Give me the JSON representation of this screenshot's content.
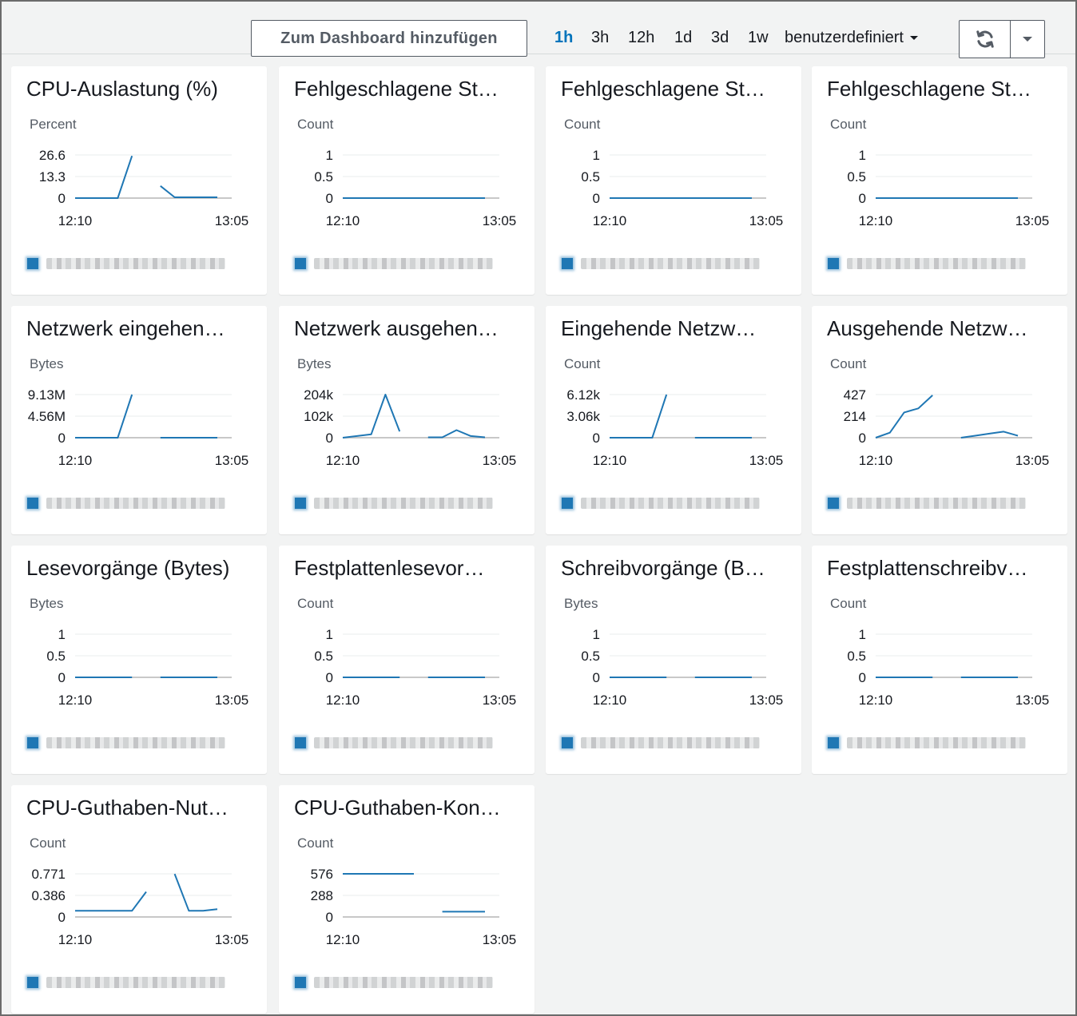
{
  "toolbar": {
    "add_to_dashboard_label": "Zum Dashboard hinzufügen",
    "ranges": [
      "1h",
      "3h",
      "12h",
      "1d",
      "3d",
      "1w",
      "benutzerdefiniert"
    ],
    "active_range": "1h",
    "refresh_icon": "refresh-icon",
    "dropdown_icon": "chevron-down-icon"
  },
  "colors": {
    "series": "#1f77b4",
    "gap": "#c8c8c8",
    "active_range": "#0073bb",
    "background": "#f2f3f3"
  },
  "chart_data": [
    {
      "type": "line",
      "title": "CPU-Auslastung (%)",
      "ylabel": "Percent",
      "y_ticks": [
        "26.6",
        "13.3",
        "0"
      ],
      "ylim": [
        0,
        26.6
      ],
      "x_ticks": [
        "12:10",
        "13:05"
      ],
      "series": [
        {
          "values": [
            0,
            0,
            0,
            0,
            26,
            null,
            7.5,
            0.5,
            0.5,
            0.5,
            0.5
          ]
        }
      ]
    },
    {
      "type": "line",
      "title": "Fehlgeschlagene St…",
      "ylabel": "Count",
      "y_ticks": [
        "1",
        "0.5",
        "0"
      ],
      "ylim": [
        0,
        1
      ],
      "x_ticks": [
        "12:10",
        "13:05"
      ],
      "series": [
        {
          "values": [
            0,
            0,
            0,
            0,
            0,
            0,
            0,
            0,
            0,
            0,
            0
          ]
        }
      ]
    },
    {
      "type": "line",
      "title": "Fehlgeschlagene St…",
      "ylabel": "Count",
      "y_ticks": [
        "1",
        "0.5",
        "0"
      ],
      "ylim": [
        0,
        1
      ],
      "x_ticks": [
        "12:10",
        "13:05"
      ],
      "series": [
        {
          "values": [
            0,
            0,
            0,
            0,
            0,
            0,
            0,
            0,
            0,
            0,
            0
          ]
        }
      ]
    },
    {
      "type": "line",
      "title": "Fehlgeschlagene St…",
      "ylabel": "Count",
      "y_ticks": [
        "1",
        "0.5",
        "0"
      ],
      "ylim": [
        0,
        1
      ],
      "x_ticks": [
        "12:10",
        "13:05"
      ],
      "series": [
        {
          "values": [
            0,
            0,
            0,
            0,
            0,
            0,
            0,
            0,
            0,
            0,
            0
          ]
        }
      ]
    },
    {
      "type": "line",
      "title": "Netzwerk eingehen…",
      "ylabel": "Bytes",
      "y_ticks": [
        "9.13M",
        "4.56M",
        "0"
      ],
      "ylim": [
        0,
        9130000
      ],
      "x_ticks": [
        "12:10",
        "13:05"
      ],
      "series": [
        {
          "values": [
            0,
            0,
            0,
            0,
            9130000,
            null,
            0,
            0,
            0,
            0,
            0
          ]
        }
      ]
    },
    {
      "type": "line",
      "title": "Netzwerk ausgehen…",
      "ylabel": "Bytes",
      "y_ticks": [
        "204k",
        "102k",
        "0"
      ],
      "ylim": [
        0,
        204000
      ],
      "x_ticks": [
        "12:10",
        "13:05"
      ],
      "series": [
        {
          "values": [
            0,
            8000,
            16000,
            204000,
            30000,
            null,
            2000,
            2000,
            36000,
            8000,
            2000
          ]
        }
      ]
    },
    {
      "type": "line",
      "title": "Eingehende Netzw…",
      "ylabel": "Count",
      "y_ticks": [
        "6.12k",
        "3.06k",
        "0"
      ],
      "ylim": [
        0,
        6120
      ],
      "x_ticks": [
        "12:10",
        "13:05"
      ],
      "series": [
        {
          "values": [
            0,
            0,
            0,
            0,
            6120,
            null,
            0,
            0,
            0,
            0,
            0
          ]
        }
      ]
    },
    {
      "type": "line",
      "title": "Ausgehende Netzw…",
      "ylabel": "Count",
      "y_ticks": [
        "427",
        "214",
        "0"
      ],
      "ylim": [
        0,
        427
      ],
      "x_ticks": [
        "12:10",
        "13:05"
      ],
      "series": [
        {
          "values": [
            0,
            50,
            250,
            290,
            420,
            null,
            0,
            20,
            40,
            60,
            20
          ]
        }
      ]
    },
    {
      "type": "line",
      "title": "Lesevorgänge (Bytes)",
      "ylabel": "Bytes",
      "y_ticks": [
        "1",
        "0.5",
        "0"
      ],
      "ylim": [
        0,
        1
      ],
      "x_ticks": [
        "12:10",
        "13:05"
      ],
      "series": [
        {
          "values": [
            0,
            0,
            0,
            0,
            0,
            null,
            0,
            0,
            0,
            0,
            0
          ]
        }
      ]
    },
    {
      "type": "line",
      "title": "Festplattenlesevor…",
      "ylabel": "Count",
      "y_ticks": [
        "1",
        "0.5",
        "0"
      ],
      "ylim": [
        0,
        1
      ],
      "x_ticks": [
        "12:10",
        "13:05"
      ],
      "series": [
        {
          "values": [
            0,
            0,
            0,
            0,
            0,
            null,
            0,
            0,
            0,
            0,
            0
          ]
        }
      ]
    },
    {
      "type": "line",
      "title": "Schreibvorgänge (B…",
      "ylabel": "Bytes",
      "y_ticks": [
        "1",
        "0.5",
        "0"
      ],
      "ylim": [
        0,
        1
      ],
      "x_ticks": [
        "12:10",
        "13:05"
      ],
      "series": [
        {
          "values": [
            0,
            0,
            0,
            0,
            0,
            null,
            0,
            0,
            0,
            0,
            0
          ]
        }
      ]
    },
    {
      "type": "line",
      "title": "Festplattenschreibv…",
      "ylabel": "Count",
      "y_ticks": [
        "1",
        "0.5",
        "0"
      ],
      "ylim": [
        0,
        1
      ],
      "x_ticks": [
        "12:10",
        "13:05"
      ],
      "series": [
        {
          "values": [
            0,
            0,
            0,
            0,
            0,
            null,
            0,
            0,
            0,
            0,
            0
          ]
        }
      ]
    },
    {
      "type": "line",
      "title": "CPU-Guthaben-Nut…",
      "ylabel": "Count",
      "y_ticks": [
        "0.771",
        "0.386",
        "0"
      ],
      "ylim": [
        0,
        0.771
      ],
      "x_ticks": [
        "12:10",
        "13:05"
      ],
      "series": [
        {
          "values": [
            0.11,
            0.11,
            0.11,
            0.11,
            0.11,
            0.45,
            null,
            0.77,
            0.11,
            0.11,
            0.14
          ]
        }
      ]
    },
    {
      "type": "line",
      "title": "CPU-Guthaben-Kon…",
      "ylabel": "Count",
      "y_ticks": [
        "576",
        "288",
        "0"
      ],
      "ylim": [
        0,
        576
      ],
      "x_ticks": [
        "12:10",
        "13:05"
      ],
      "series": [
        {
          "values": [
            576,
            576,
            576,
            576,
            576,
            576,
            null,
            70,
            70,
            70,
            70
          ]
        }
      ]
    }
  ]
}
